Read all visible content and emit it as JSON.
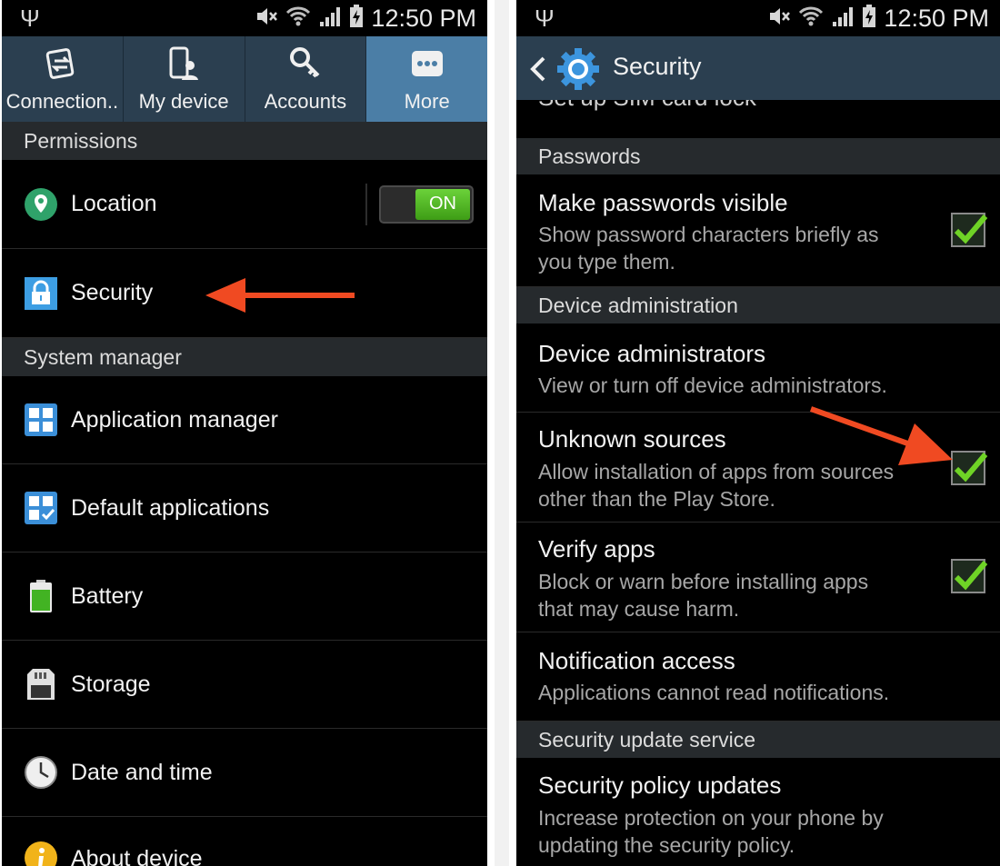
{
  "status_bar": {
    "time": "12:50 PM",
    "icons": [
      "usb-icon",
      "mute-icon",
      "wifi-icon",
      "signal-icon",
      "battery-icon"
    ]
  },
  "left_screen": {
    "tabs": [
      {
        "label": "Connection..",
        "icon": "connections-icon"
      },
      {
        "label": "My device",
        "icon": "my-device-icon"
      },
      {
        "label": "Accounts",
        "icon": "accounts-key-icon"
      },
      {
        "label": "More",
        "icon": "more-dots-icon",
        "active": true
      }
    ],
    "sections": {
      "permissions": "Permissions",
      "system_manager": "System manager"
    },
    "rows": {
      "location": {
        "label": "Location",
        "toggle": "ON",
        "icon": "location-pin-icon"
      },
      "security": {
        "label": "Security",
        "icon": "security-lock-icon"
      },
      "application_manager": {
        "label": "Application manager",
        "icon": "application-manager-icon"
      },
      "default_applications": {
        "label": "Default applications",
        "icon": "default-apps-icon"
      },
      "battery": {
        "label": "Battery",
        "icon": "battery-large-icon"
      },
      "storage": {
        "label": "Storage",
        "icon": "sd-card-icon"
      },
      "date_time": {
        "label": "Date and time",
        "icon": "clock-icon"
      },
      "about": {
        "label": "About device",
        "icon": "info-icon"
      }
    }
  },
  "right_screen": {
    "title": "Security",
    "cutoff_text": "Set up SIM card lock",
    "sections": {
      "passwords": "Passwords",
      "device_admin": "Device administration",
      "security_update": "Security update service"
    },
    "rows": {
      "passwords_visible": {
        "title": "Make passwords visible",
        "sub1": "Show password characters briefly as",
        "sub2": "you type them.",
        "checked": true
      },
      "device_admins": {
        "title": "Device administrators",
        "sub1": "View or turn off device administrators."
      },
      "unknown_sources": {
        "title": "Unknown sources",
        "sub1": "Allow installation of apps from sources",
        "sub2": "other than the Play Store.",
        "checked": true
      },
      "verify_apps": {
        "title": "Verify apps",
        "sub1": "Block or warn before installing apps",
        "sub2": "that may cause harm.",
        "checked": true
      },
      "notification_access": {
        "title": "Notification access",
        "sub1": "Applications cannot read notifications."
      },
      "security_policy": {
        "title": "Security policy updates",
        "sub1": "Increase protection on your phone by",
        "sub2": "updating the security policy."
      }
    }
  },
  "colors": {
    "accent_tab": "#4b7ea6",
    "header_bg": "#2b3f50",
    "section_bg": "#262a2d",
    "toggle_on": "#4fb520",
    "check_green": "#6fd326",
    "annotation_arrow": "#f04a22"
  }
}
